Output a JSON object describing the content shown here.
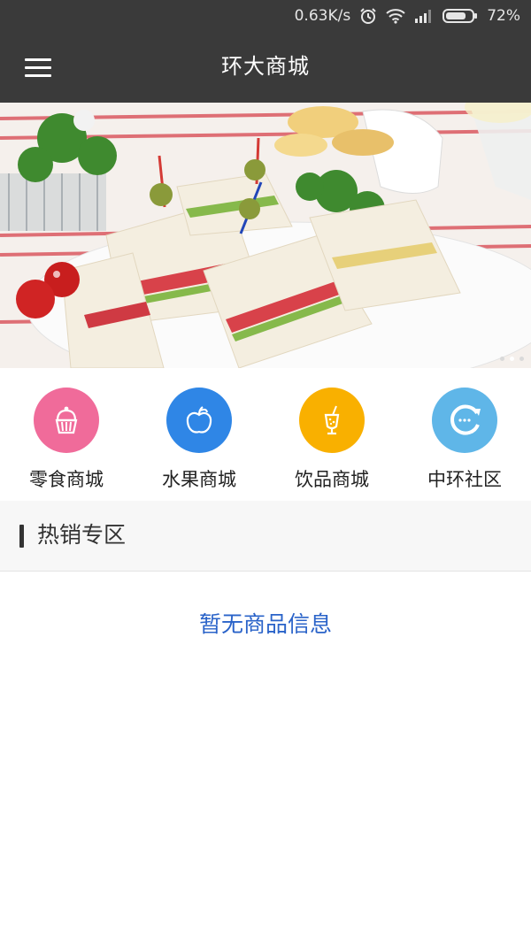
{
  "status_bar": {
    "net_speed": "0.63K/s",
    "battery": "72%",
    "icons": [
      "alarm-icon",
      "wifi-icon",
      "signal-icon",
      "battery-icon"
    ]
  },
  "app_bar": {
    "title": "环大商城",
    "menu_icon": "hamburger-menu-icon"
  },
  "banner": {
    "description_icon": "banner-image",
    "slide_count": 3,
    "active_slide": 2
  },
  "categories": [
    {
      "label": "零食商城",
      "icon": "cupcake-icon",
      "color": "#f06b9a"
    },
    {
      "label": "水果商城",
      "icon": "apple-icon",
      "color": "#2f86e6"
    },
    {
      "label": "饮品商城",
      "icon": "drink-icon",
      "color": "#f9b000"
    },
    {
      "label": "中环社区",
      "icon": "chat-icon",
      "color": "#5fb6e8"
    }
  ],
  "hot_section": {
    "title": "热销专区",
    "empty_message": "暂无商品信息"
  },
  "colors": {
    "app_bar": "#3a3a3a",
    "link_blue": "#2a63c9"
  }
}
